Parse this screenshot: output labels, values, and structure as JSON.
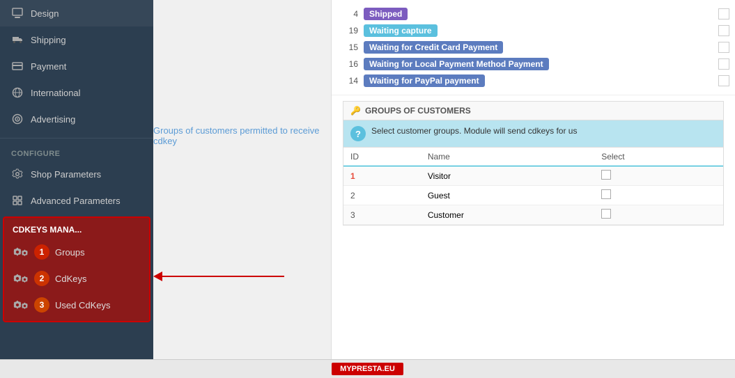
{
  "sidebar": {
    "items": [
      {
        "id": "design",
        "label": "Design",
        "icon": "design-icon"
      },
      {
        "id": "shipping",
        "label": "Shipping",
        "icon": "shipping-icon"
      },
      {
        "id": "payment",
        "label": "Payment",
        "icon": "payment-icon"
      },
      {
        "id": "international",
        "label": "International",
        "icon": "international-icon"
      },
      {
        "id": "advertising",
        "label": "Advertising",
        "icon": "advertising-icon"
      }
    ],
    "configure_label": "CONFIGURE",
    "configure_items": [
      {
        "id": "shop-parameters",
        "label": "Shop Parameters"
      },
      {
        "id": "advanced-parameters",
        "label": "Advanced Parameters"
      }
    ],
    "cdkeys_title": "CDKEYS MANA...",
    "cdkeys_items": [
      {
        "id": "groups",
        "label": "Groups",
        "step": "1"
      },
      {
        "id": "cdkeys",
        "label": "CdKeys",
        "step": "2"
      },
      {
        "id": "used-cdkeys",
        "label": "Used CdKeys",
        "step": "3"
      }
    ]
  },
  "statuses": {
    "rows": [
      {
        "id": "4",
        "label": "Shipped",
        "badge_class": "shipped"
      },
      {
        "id": "19",
        "label": "Waiting capture",
        "badge_class": "capture"
      },
      {
        "id": "15",
        "label": "Waiting for Credit Card Payment",
        "badge_class": "credit"
      },
      {
        "id": "16",
        "label": "Waiting for Local Payment Method Payment",
        "badge_class": "local"
      },
      {
        "id": "14",
        "label": "Waiting for PayPal payment",
        "badge_class": "paypal"
      }
    ]
  },
  "groups_label": "Groups of customers permitted to receive cdkey",
  "groups_panel": {
    "title": "GROUPS OF CUSTOMERS",
    "info_text": "Select customer groups. Module will send cdkeys for us",
    "table": {
      "headers": [
        "ID",
        "Name",
        "Select"
      ],
      "rows": [
        {
          "id": "1",
          "name": "Visitor",
          "id_class": "row-id-1"
        },
        {
          "id": "2",
          "name": "Guest",
          "id_class": "row-id-2"
        },
        {
          "id": "3",
          "name": "Customer",
          "id_class": "row-id-3"
        }
      ]
    }
  },
  "footer": {
    "label": "MYPRESTA.EU"
  }
}
